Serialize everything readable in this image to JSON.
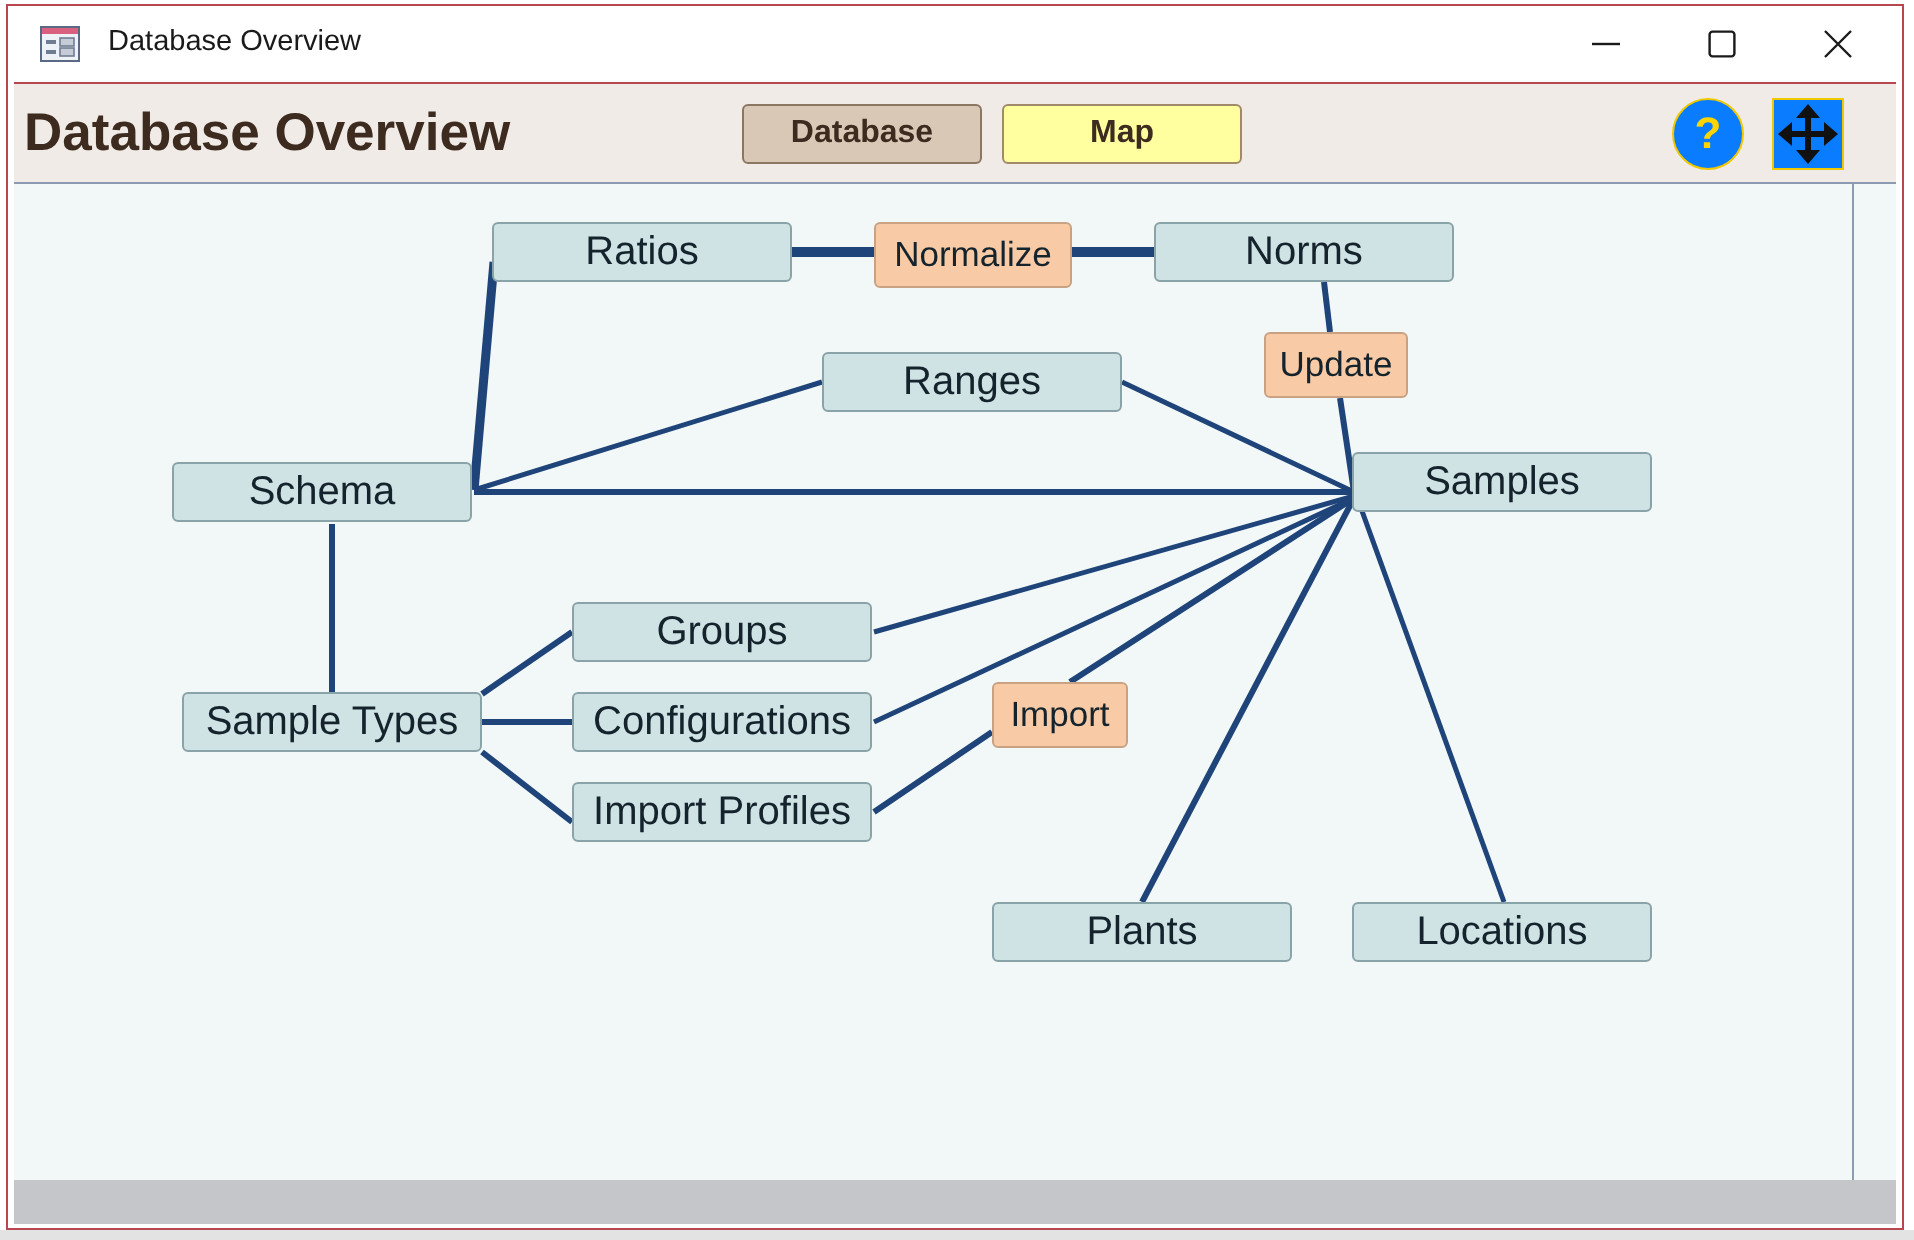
{
  "window": {
    "title": "Database Overview"
  },
  "header": {
    "title": "Database Overview",
    "tabs": [
      {
        "label": "Database",
        "selected": false
      },
      {
        "label": "Map",
        "selected": true
      }
    ],
    "help_button": {
      "label": "?"
    }
  },
  "diagram": {
    "nodes": [
      {
        "label": "Ratios",
        "kind": "table"
      },
      {
        "label": "Normalize",
        "kind": "action"
      },
      {
        "label": "Norms",
        "kind": "table"
      },
      {
        "label": "Update",
        "kind": "action"
      },
      {
        "label": "Ranges",
        "kind": "table"
      },
      {
        "label": "Schema",
        "kind": "table"
      },
      {
        "label": "Samples",
        "kind": "table"
      },
      {
        "label": "Groups",
        "kind": "table"
      },
      {
        "label": "Sample Types",
        "kind": "table"
      },
      {
        "label": "Configurations",
        "kind": "table"
      },
      {
        "label": "Import",
        "kind": "action"
      },
      {
        "label": "Import Profiles",
        "kind": "table"
      },
      {
        "label": "Plants",
        "kind": "table"
      },
      {
        "label": "Locations",
        "kind": "table"
      }
    ]
  }
}
